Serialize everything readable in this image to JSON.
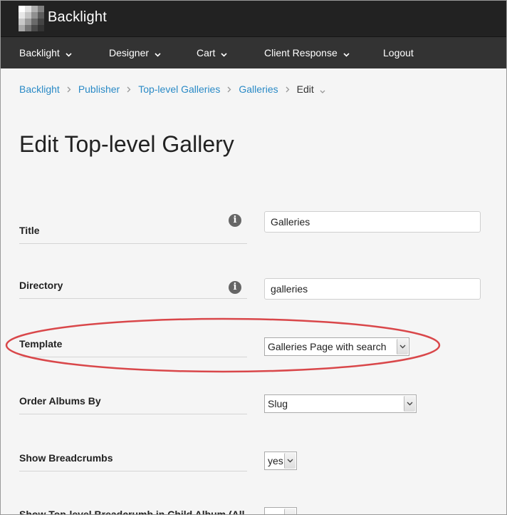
{
  "app": {
    "title": "Backlight"
  },
  "nav": [
    {
      "label": "Backlight",
      "has_dropdown": true
    },
    {
      "label": "Designer",
      "has_dropdown": true
    },
    {
      "label": "Cart",
      "has_dropdown": true
    },
    {
      "label": "Client Response",
      "has_dropdown": true
    },
    {
      "label": "Logout",
      "has_dropdown": false
    }
  ],
  "breadcrumb": {
    "items": [
      "Backlight",
      "Publisher",
      "Top-level Galleries",
      "Galleries"
    ],
    "current": "Edit"
  },
  "page": {
    "title": "Edit Top-level Gallery"
  },
  "form": {
    "title": {
      "label": "Title",
      "value": "Galleries",
      "has_info": true
    },
    "directory": {
      "label": "Directory",
      "value": "galleries",
      "has_info": true
    },
    "template": {
      "label": "Template",
      "value": "Galleries Page with search"
    },
    "order_albums_by": {
      "label": "Order Albums By",
      "value": "Slug"
    },
    "show_breadcrumbs": {
      "label": "Show Breadcrumbs",
      "value": "yes"
    },
    "partial_row": {
      "label": "Show Top-level Breadcrumb in Child Album (All"
    }
  },
  "colors": {
    "topbar": "#222222",
    "navbar": "#333333",
    "link": "#2a8ac6",
    "annotation": "#d9474a"
  }
}
